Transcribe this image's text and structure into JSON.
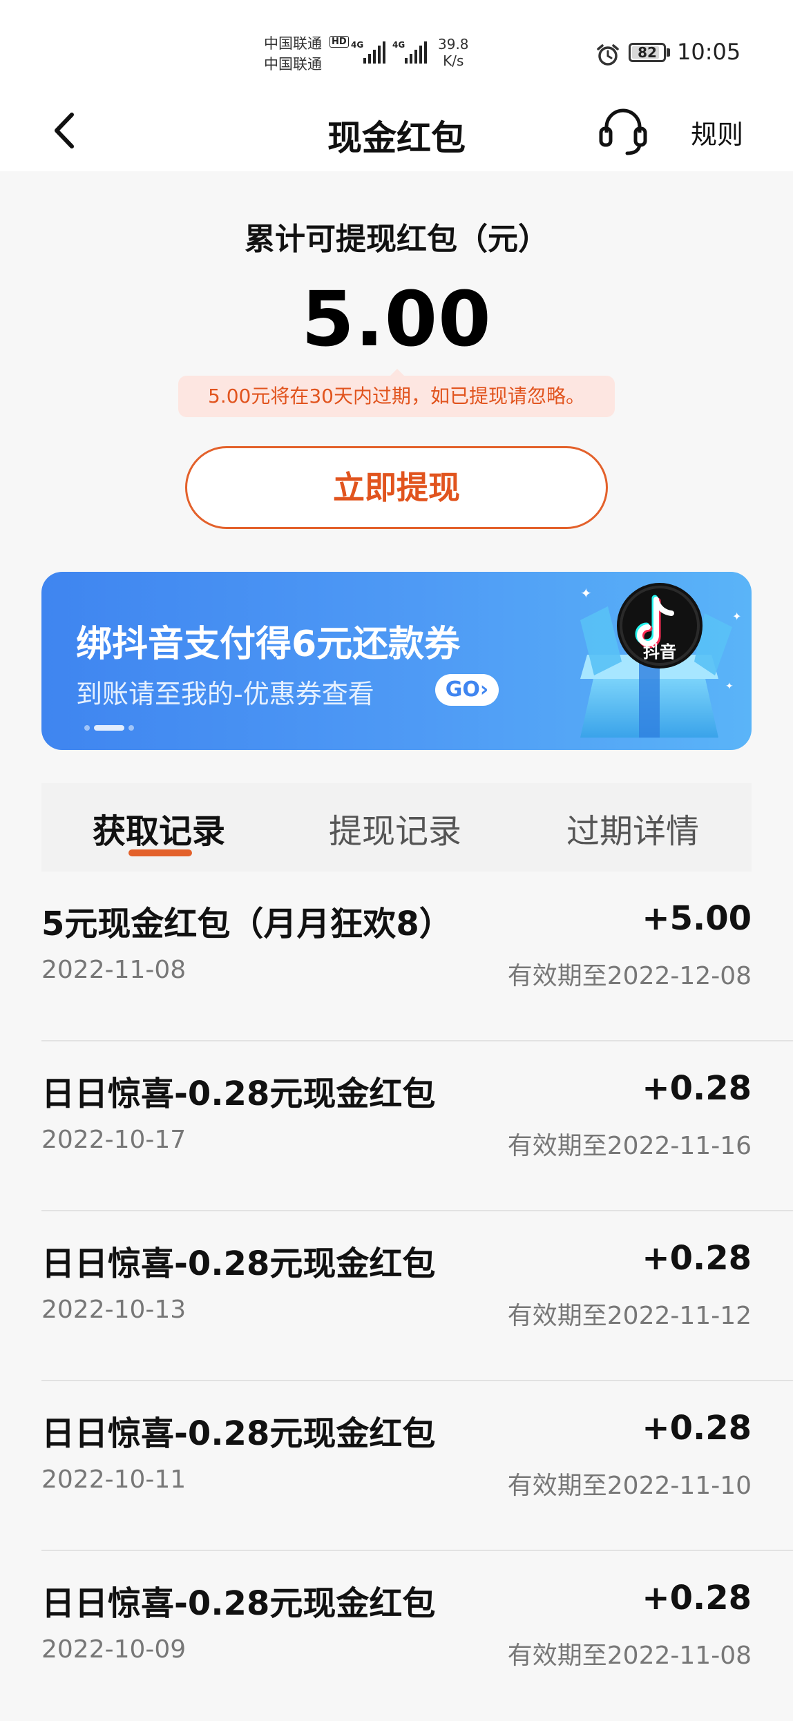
{
  "status_bar": {
    "carrier_1": "中国联通",
    "carrier_2": "中国联通",
    "hd_badge": "HD",
    "signal_1_label": "4G",
    "signal_2_label": "4G",
    "net_speed_value": "39.8",
    "net_speed_unit": "K/s",
    "battery": "82",
    "time": "10:05"
  },
  "nav": {
    "title": "现金红包",
    "rules": "规则"
  },
  "balance": {
    "label": "累计可提现红包（元）",
    "amount": "5.00",
    "notice": "5.00元将在30天内过期，如已提现请忽略。",
    "withdraw_button": "立即提现"
  },
  "banner": {
    "title": "绑抖音支付得6元还款券",
    "subtitle": "到账请至我的-优惠券查看",
    "go": "GO",
    "brand": "抖音",
    "slide_count": 3,
    "active_slide": 2
  },
  "tabs": [
    {
      "label": "获取记录",
      "active": true
    },
    {
      "label": "提现记录",
      "active": false
    },
    {
      "label": "过期详情",
      "active": false
    }
  ],
  "records": [
    {
      "title": "5元现金红包（月月狂欢8）",
      "date": "2022-11-08",
      "amount": "+5.00",
      "expiry": "有效期至2022-12-08"
    },
    {
      "title": "日日惊喜-0.28元现金红包",
      "date": "2022-10-17",
      "amount": "+0.28",
      "expiry": "有效期至2022-11-16"
    },
    {
      "title": "日日惊喜-0.28元现金红包",
      "date": "2022-10-13",
      "amount": "+0.28",
      "expiry": "有效期至2022-11-12"
    },
    {
      "title": "日日惊喜-0.28元现金红包",
      "date": "2022-10-11",
      "amount": "+0.28",
      "expiry": "有效期至2022-11-10"
    },
    {
      "title": "日日惊喜-0.28元现金红包",
      "date": "2022-10-09",
      "amount": "+0.28",
      "expiry": "有效期至2022-11-08"
    }
  ],
  "colors": {
    "accent": "#e3612b",
    "notice_bg": "#fde6e1",
    "banner_blue": "#4f9bf5"
  }
}
